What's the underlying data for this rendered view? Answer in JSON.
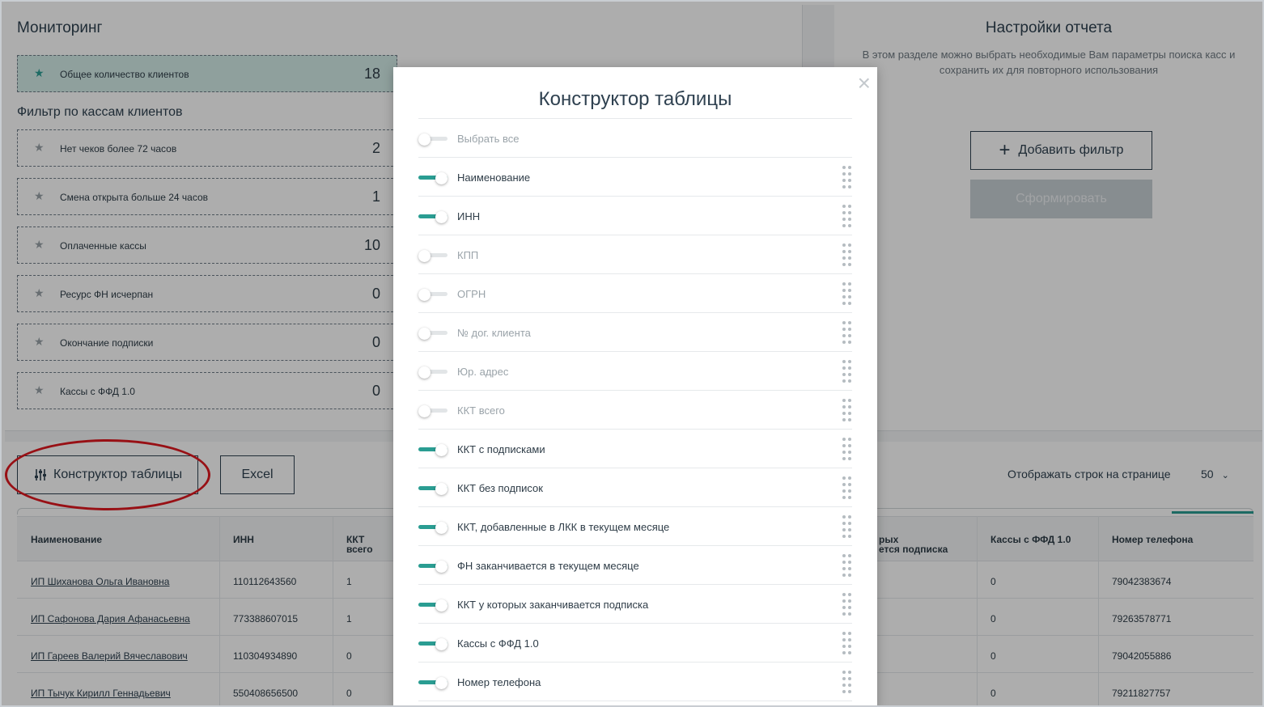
{
  "monitoring": {
    "title": "Мониторинг",
    "total": {
      "label": "Общее количество клиентов",
      "count": "18"
    },
    "filter_title": "Фильтр по кассам клиентов",
    "filters": [
      {
        "label": "Нет чеков более 72 часов",
        "count": "2"
      },
      {
        "label": "Смена открыта больше 24 часов",
        "count": "1"
      },
      {
        "label": "Оплаченные кассы",
        "count": "10"
      },
      {
        "label": "Ресурс ФН исчерпан",
        "count": "0"
      },
      {
        "label": "Окончание подписки",
        "count": "0"
      },
      {
        "label": "Кассы с ФФД 1.0",
        "count": "0"
      }
    ]
  },
  "report_settings": {
    "title": "Настройки отчета",
    "description": "В этом разделе можно выбрать необходимые Вам параметры поиска касс и сохранить их для повторного использования",
    "add_filter_label": "Добавить фильтр",
    "generate_label": "Сформировать"
  },
  "toolbar": {
    "constructor_label": "Конструктор таблицы",
    "excel_label": "Excel",
    "rows_per_page_label": "Отображать строк на странице",
    "rows_per_page_value": "50"
  },
  "table": {
    "headers": {
      "name": "Наименование",
      "inn": "ИНН",
      "kkt_total_1": "ККТ",
      "kkt_total_2": "всего",
      "partial_1": "рых",
      "partial_2": "ется подписка",
      "ffd": "Кассы с ФФД 1.0",
      "phone": "Номер телефона"
    },
    "rows": [
      {
        "name": "ИП Шиханова Ольга Ивановна",
        "inn": "110112643560",
        "kkt": "1",
        "ffd": "0",
        "phone": "79042383674"
      },
      {
        "name": "ИП Сафонова Дария Афанасьевна",
        "inn": "773388607015",
        "kkt": "1",
        "ffd": "0",
        "phone": "79263578771"
      },
      {
        "name": "ИП Гареев Валерий Вячеславович",
        "inn": "110304934890",
        "kkt": "0",
        "ffd": "0",
        "phone": "79042055886"
      },
      {
        "name": "ИП Тычук Кирилл Геннадьевич",
        "inn": "550408656500",
        "kkt": "0",
        "ffd": "0",
        "phone": "79211827757"
      }
    ]
  },
  "modal": {
    "title": "Конструктор таблицы",
    "close_symbol": "×",
    "select_all": {
      "label": "Выбрать все",
      "on": false
    },
    "options": [
      {
        "label": "Наименование",
        "on": true
      },
      {
        "label": "ИНН",
        "on": true
      },
      {
        "label": "КПП",
        "on": false
      },
      {
        "label": "ОГРН",
        "on": false
      },
      {
        "label": "№ дог. клиента",
        "on": false
      },
      {
        "label": "Юр. адрес",
        "on": false
      },
      {
        "label": "ККТ всего",
        "on": false
      },
      {
        "label": "ККТ с подписками",
        "on": true
      },
      {
        "label": "ККТ без подписок",
        "on": true
      },
      {
        "label": "ККТ, добавленные в ЛКК в текущем месяце",
        "on": true
      },
      {
        "label": "ФН заканчивается в текущем месяце",
        "on": true
      },
      {
        "label": "ККТ у которых заканчивается подписка",
        "on": true
      },
      {
        "label": "Кассы с ФФД 1.0",
        "on": true
      },
      {
        "label": "Номер телефона",
        "on": true
      }
    ]
  },
  "colors": {
    "accent": "#2a9d92",
    "text_dark": "#2f4150",
    "highlight_ellipse": "#e0191f"
  },
  "icons": {
    "star": "★",
    "plus": "+",
    "sliders": "sliders-icon",
    "chevron": "⌄"
  }
}
